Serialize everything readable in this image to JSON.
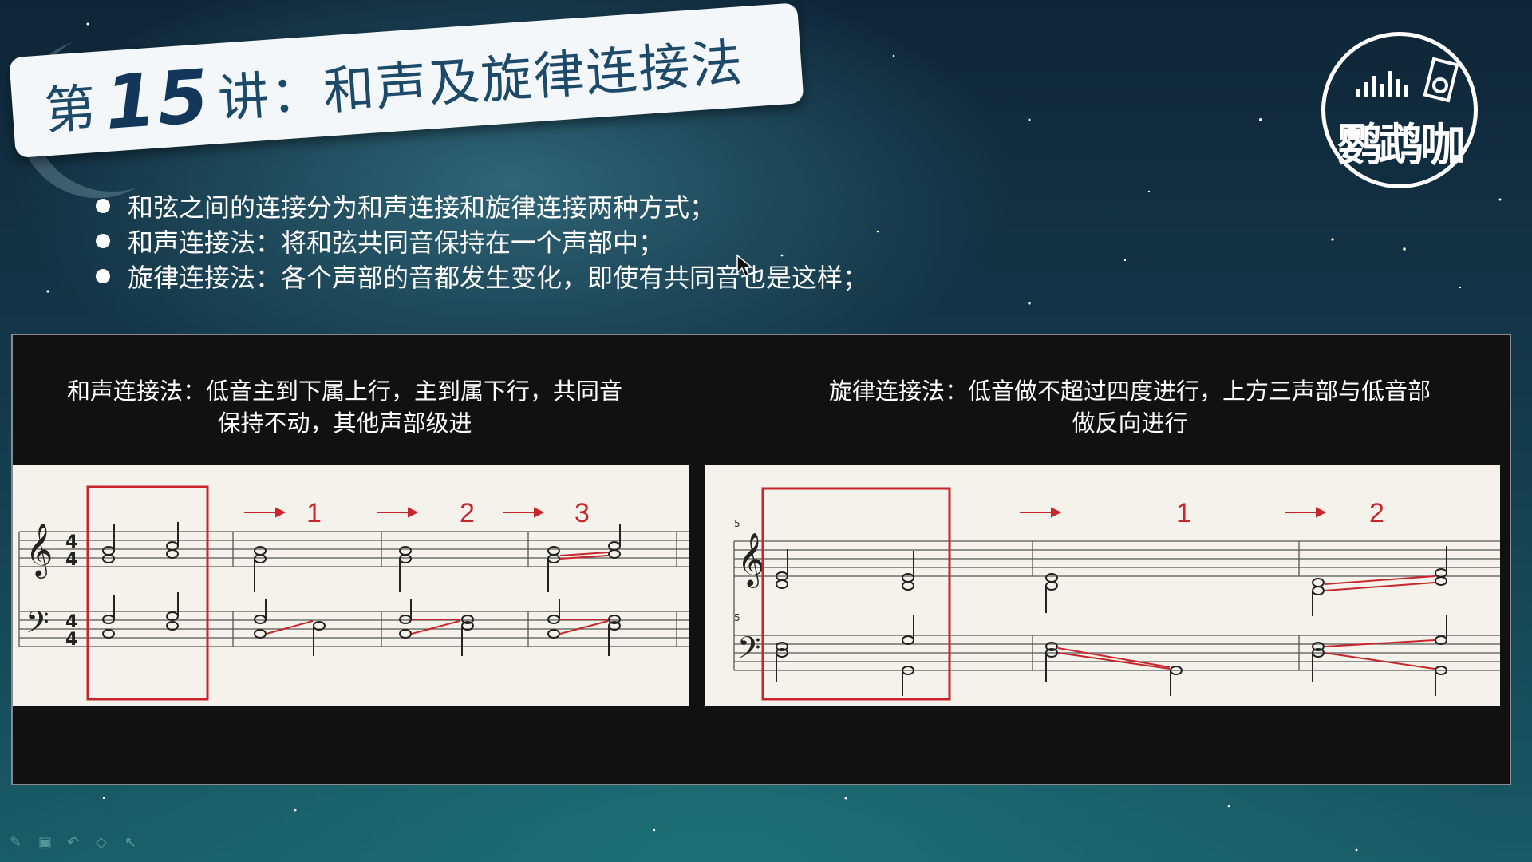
{
  "slide": {
    "title_prefix": "第",
    "title_number": "15",
    "title_suffix": "讲：和声及旋律连接法",
    "logo_text": "鹦鹉咖",
    "bullets": [
      "和弦之间的连接分为和声连接和旋律连接两种方式；",
      "和声连接法：将和弦共同音保持在一个声部中；",
      "旋律连接法：各个声部的音都发生变化，即使有共同音也是这样；"
    ],
    "left_caption_line1": "和声连接法：低音主到下属上行，主到属下行，共同音",
    "left_caption_line2": "保持不动，其他声部级进",
    "right_caption_line1": "旋律连接法：低音做不超过四度进行，上方三声部与低音部",
    "right_caption_line2": "做反向进行",
    "left_score_labels": [
      "1",
      "2",
      "3"
    ],
    "right_score_labels": [
      "1",
      "2"
    ],
    "time_signature_top": "4",
    "time_signature_bottom": "4",
    "measure_number": "5"
  },
  "colors": {
    "accent_red": "#c8262c",
    "title_blue": "#1e4a6a",
    "panel_bg": "#111111",
    "score_bg": "#f4f2ea"
  },
  "icons": [
    "logo-equalizer-icon",
    "logo-speaker-icon",
    "treble-clef-icon",
    "bass-clef-icon",
    "arrow-right-icon",
    "mouse-cursor-icon",
    "pen-tool-icon"
  ]
}
